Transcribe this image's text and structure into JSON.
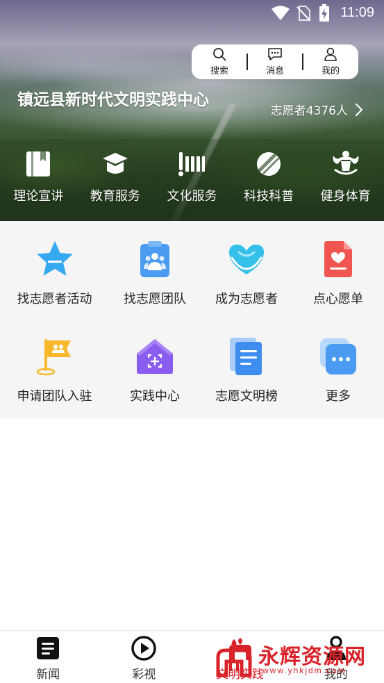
{
  "status_bar": {
    "time": "11:09",
    "icons": [
      "wifi-icon",
      "no-sim-icon",
      "battery-charging-icon"
    ]
  },
  "top_actions": [
    {
      "label": "搜索",
      "icon": "search-icon"
    },
    {
      "label": "消息",
      "icon": "message-icon"
    },
    {
      "label": "我的",
      "icon": "user-icon"
    }
  ],
  "center": {
    "title": "镇远县新时代文明实践中心",
    "volunteer_count": "志愿者4376人"
  },
  "hero_categories": [
    {
      "label": "理论宣讲",
      "icon": "book-icon"
    },
    {
      "label": "教育服务",
      "icon": "graduation-cap-icon"
    },
    {
      "label": "文化服务",
      "icon": "culture-icon"
    },
    {
      "label": "科技科普",
      "icon": "science-icon"
    },
    {
      "label": "健身体育",
      "icon": "fitness-icon"
    }
  ],
  "grid_items": [
    {
      "label": "找志愿者活动",
      "icon": "star-badge-icon"
    },
    {
      "label": "找志愿团队",
      "icon": "team-clipboard-icon"
    },
    {
      "label": "成为志愿者",
      "icon": "heart-hands-icon"
    },
    {
      "label": "点心愿单",
      "icon": "wish-list-icon"
    },
    {
      "label": "申请团队入驻",
      "icon": "team-flag-icon"
    },
    {
      "label": "实践中心",
      "icon": "practice-center-icon"
    },
    {
      "label": "志愿文明榜",
      "icon": "document-list-icon"
    },
    {
      "label": "更多",
      "icon": "more-icon"
    }
  ],
  "bottom_nav": [
    {
      "label": "新闻",
      "icon": "news-icon"
    },
    {
      "label": "彩视",
      "icon": "play-icon"
    },
    {
      "label": "文明实践",
      "icon": "civilization-icon",
      "active": true
    },
    {
      "label": "我的",
      "icon": "profile-icon"
    }
  ],
  "watermark": {
    "text": "永辉资源网",
    "url": "www.yhkjdm.com"
  },
  "colors": {
    "accent_red": "#d9232a",
    "grid_background": "#f5f5f5",
    "star_blue": "#35a9f0",
    "team_blue": "#4a9cf2",
    "heart_cyan": "#34c0e8",
    "wish_red": "#f0554f",
    "flag_yellow": "#f7b82a",
    "house_purple": "#8a5cf0",
    "doc_blue": "#3e8ef0",
    "more_blue": "#4a9af2"
  }
}
